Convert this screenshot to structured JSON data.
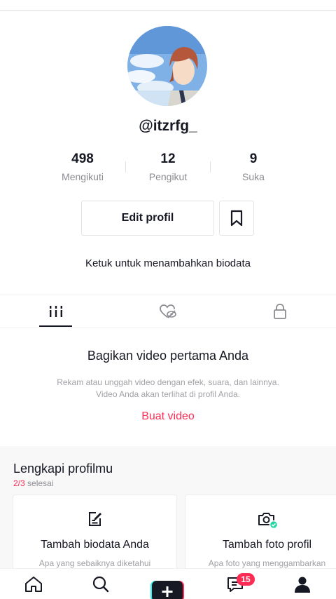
{
  "profile": {
    "username": "@itzrfg_"
  },
  "stats": [
    {
      "value": "498",
      "label": "Mengikuti"
    },
    {
      "value": "12",
      "label": "Pengikut"
    },
    {
      "value": "9",
      "label": "Suka"
    }
  ],
  "actions": {
    "edit_label": "Edit profil",
    "bookmark_icon": "bookmark-icon"
  },
  "bio_hint": "Ketuk untuk menambahkan biodata",
  "tabs": [
    {
      "icon": "grid-icon",
      "active": true
    },
    {
      "icon": "liked-hidden-icon",
      "active": false
    },
    {
      "icon": "lock-icon",
      "active": false
    }
  ],
  "empty_state": {
    "title": "Bagikan video pertama Anda",
    "description_line1": "Rekam atau unggah video dengan efek, suara, dan lainnya.",
    "description_line2": "Video Anda akan terlihat di profil Anda.",
    "cta": "Buat video"
  },
  "complete_profile": {
    "title": "Lengkapi profilmu",
    "progress_done": "2/3",
    "progress_suffix": "selesai",
    "cards": [
      {
        "icon": "edit-bio-icon",
        "title": "Tambah biodata Anda",
        "description": "Apa yang sebaiknya diketahui"
      },
      {
        "icon": "camera-icon",
        "title": "Tambah foto profil",
        "description": "Apa foto yang menggambarkan"
      }
    ]
  },
  "bottom_nav": {
    "items": [
      "home-icon",
      "search-icon",
      "create-icon",
      "inbox-icon",
      "profile-icon"
    ],
    "inbox_badge": "15"
  },
  "colors": {
    "accent": "#fe2c55",
    "text": "#161823",
    "muted": "#8a8b91",
    "cyan": "#25f4ee"
  }
}
